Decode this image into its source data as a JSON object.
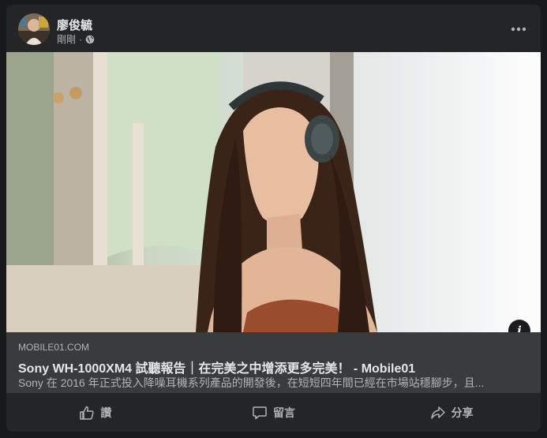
{
  "post": {
    "author": "廖俊毓",
    "time": "剛剛",
    "privacy_icon": "globe-icon",
    "more_icon": "more-options-icon"
  },
  "link": {
    "domain": "MOBILE01.COM",
    "title": "Sony WH-1000XM4 試聽報告｜在完美之中增添更多完美！ - Mobile01",
    "description": "Sony 在 2016 年正式投入降噪耳機系列產品的開發後，在短短四年間已經在市場站穩腳步，且..."
  },
  "info_icon": "i",
  "actions": {
    "like": "讚",
    "comment": "留言",
    "share": "分享"
  }
}
